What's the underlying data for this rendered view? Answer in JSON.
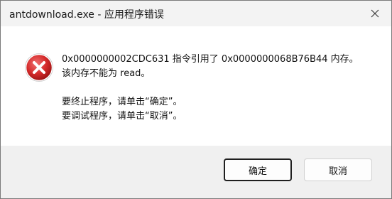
{
  "window": {
    "title": "antdownload.exe - 应用程序错误"
  },
  "icon": {
    "name": "error-icon",
    "color": "#d42a2a"
  },
  "message": {
    "line1": "0x0000000002CDC631 指令引用了 0x0000000068B76B44 内存。",
    "line2": "该内存不能为 read。",
    "line3": "要终止程序，请单击“确定”。",
    "line4": "要调试程序，请单击“取消”。"
  },
  "buttons": {
    "ok_label": "确定",
    "cancel_label": "取消"
  }
}
